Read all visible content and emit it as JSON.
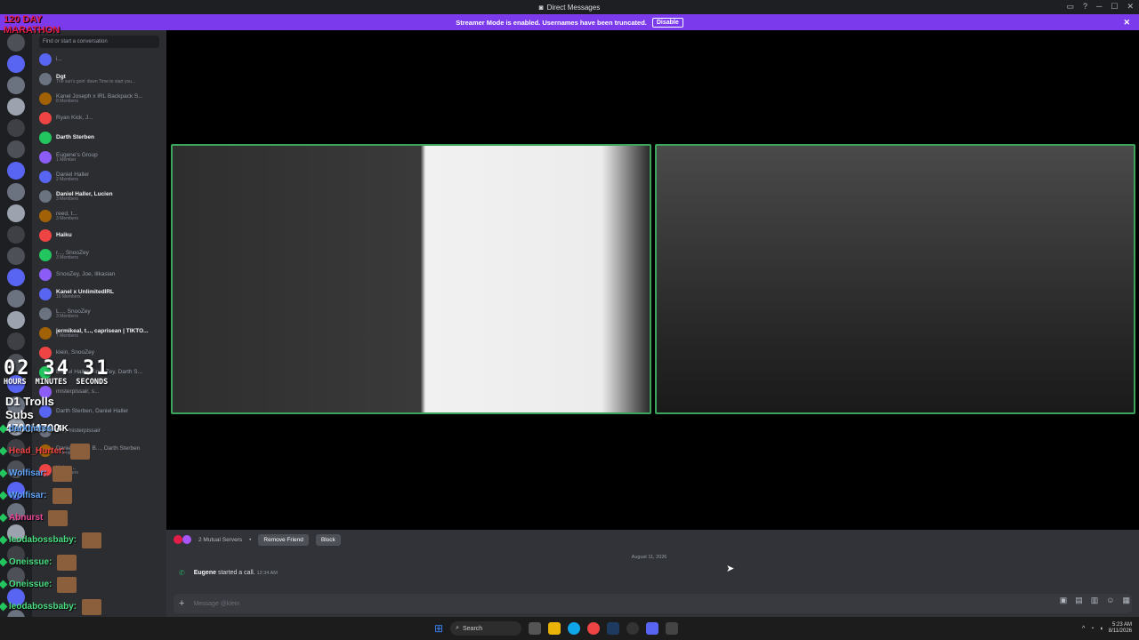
{
  "window": {
    "title": "Direct Messages"
  },
  "banner": {
    "text": "Streamer Mode is enabled. Usernames have been truncated.",
    "disable_label": "Disable"
  },
  "dm_search": {
    "placeholder": "Find or start a conversation"
  },
  "dms": [
    {
      "name": "i...",
      "sub": "",
      "bold": false
    },
    {
      "name": "Dgt",
      "sub": "The sun's goin' down Time to start you...",
      "bold": true
    },
    {
      "name": "Kanel Joseph x IRL Backpack S...",
      "sub": "8 Members",
      "bold": false
    },
    {
      "name": "Ryan Kick, J...",
      "sub": "",
      "bold": false
    },
    {
      "name": "Darth Sterben",
      "sub": "",
      "bold": true
    },
    {
      "name": "Eugene's Group",
      "sub": "1 Member",
      "bold": false
    },
    {
      "name": "Daniel Haller",
      "sub": "2 Members",
      "bold": false
    },
    {
      "name": "Daniel Haller, Lucien",
      "sub": "3 Members",
      "bold": true
    },
    {
      "name": "reed, t...",
      "sub": "3 Members",
      "bold": false
    },
    {
      "name": "Haiku",
      "sub": "",
      "bold": true
    },
    {
      "name": "r..., SnooZey",
      "sub": "3 Members",
      "bold": false
    },
    {
      "name": "SnooZey, Joe, lilkasian",
      "sub": "",
      "bold": false
    },
    {
      "name": "Kanel x UnlimitedIRL",
      "sub": "10 Members",
      "bold": true
    },
    {
      "name": "L..., SnooZey",
      "sub": "3 Members",
      "bold": false
    },
    {
      "name": "jermikeal, t..., caprisean | TIKTO...",
      "sub": "7 Members",
      "bold": true
    },
    {
      "name": "klein, SnooZey",
      "sub": "",
      "bold": false
    },
    {
      "name": "Daniel Haller, SnooZey, Darth S...",
      "sub": "",
      "bold": false
    },
    {
      "name": "misterpissair, s...",
      "sub": "",
      "bold": false
    },
    {
      "name": "Darth Sterben, Daniel Haller",
      "sub": "",
      "bold": false
    },
    {
      "name": "B..., misterpissair",
      "sub": "",
      "bold": false
    },
    {
      "name": "Daniel Haller, B..., Darth Sterben",
      "sub": "4 Members",
      "bold": false
    },
    {
      "name": "Kaker...",
      "sub": "7 Members",
      "bold": false
    }
  ],
  "overlay": {
    "logo_top": "120 DAY MARATHON",
    "timer": {
      "hours": "02",
      "minutes": "34",
      "seconds": "31",
      "hours_label": "HOURS",
      "minutes_label": "MINUTES",
      "seconds_label": "SECONDS"
    },
    "subs_goal": "D1 Trolls Subs 4700/4700",
    "chat": [
      {
        "user": "darktintss:",
        "msg": "4K",
        "color": "#60a5fa"
      },
      {
        "user": "Head_Hurter:",
        "msg": "",
        "color": "#ef4444"
      },
      {
        "user": "Wolfisar:",
        "msg": "",
        "color": "#60a5fa"
      },
      {
        "user": "Wolfisar:",
        "msg": "",
        "color": "#60a5fa"
      },
      {
        "user": "Abnurst",
        "msg": "",
        "color": "#ec4899"
      },
      {
        "user": "leodabossbaby:",
        "msg": "",
        "color": "#4ade80"
      },
      {
        "user": "Oneissue:",
        "msg": "",
        "color": "#4ade80"
      },
      {
        "user": "Oneissue:",
        "msg": "",
        "color": "#4ade80"
      },
      {
        "user": "leodabossbaby:",
        "msg": "",
        "color": "#4ade80"
      }
    ]
  },
  "profile": {
    "mutual_servers": "2 Mutual Servers",
    "remove_friend": "Remove Friend",
    "block": "Block"
  },
  "messages": {
    "date_divider": "August 11, 2026",
    "call_user": "Eugene",
    "call_text": "started a call.",
    "call_time": "12:34 AM"
  },
  "composer": {
    "placeholder": "Message @klein"
  },
  "taskbar": {
    "search": "Search",
    "time": "5:23 AM",
    "date": "8/11/2026"
  },
  "colors": {
    "accent": "#7c3aed",
    "speaking": "#3ba55c",
    "call_green": "#23a55a"
  }
}
